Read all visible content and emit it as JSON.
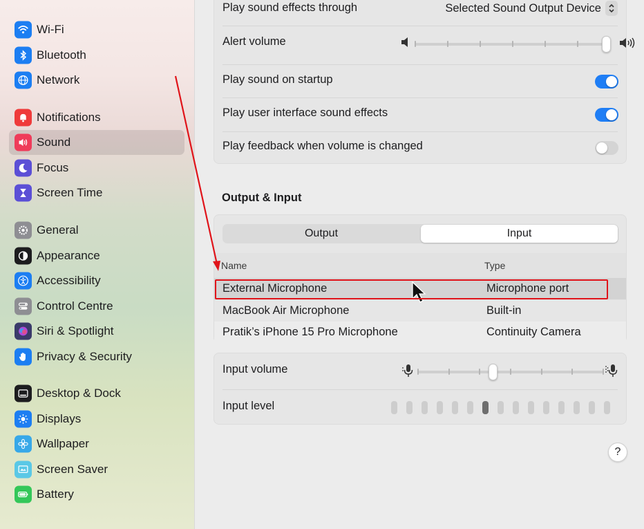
{
  "sidebar": {
    "items": [
      {
        "label": "Wi-Fi",
        "icon": "wifi-icon",
        "color": "#1c7ef2"
      },
      {
        "label": "Bluetooth",
        "icon": "bluetooth-icon",
        "color": "#1c7ef2"
      },
      {
        "label": "Network",
        "icon": "globe-icon",
        "color": "#1c7ef2"
      },
      {
        "label": "Notifications",
        "icon": "bell-icon",
        "color": "#ef3b3b"
      },
      {
        "label": "Sound",
        "icon": "speaker-icon",
        "color": "#ef3b5a"
      },
      {
        "label": "Focus",
        "icon": "moon-icon",
        "color": "#5b4fd6"
      },
      {
        "label": "Screen Time",
        "icon": "hourglass-icon",
        "color": "#5b4fd6"
      },
      {
        "label": "General",
        "icon": "gear-icon",
        "color": "#8e8e93"
      },
      {
        "label": "Appearance",
        "icon": "appearance-icon",
        "color": "#1d1d1f"
      },
      {
        "label": "Accessibility",
        "icon": "accessibility-icon",
        "color": "#1c7ef2"
      },
      {
        "label": "Control Centre",
        "icon": "control-centre-icon",
        "color": "#8e8e93"
      },
      {
        "label": "Siri & Spotlight",
        "icon": "siri-icon",
        "color": "#3a3a6a"
      },
      {
        "label": "Privacy & Security",
        "icon": "hand-icon",
        "color": "#1c7ef2"
      },
      {
        "label": "Desktop & Dock",
        "icon": "dock-icon",
        "color": "#1d1d1f"
      },
      {
        "label": "Displays",
        "icon": "sun-icon",
        "color": "#1c7ef2"
      },
      {
        "label": "Wallpaper",
        "icon": "flower-icon",
        "color": "#37a8e8"
      },
      {
        "label": "Screen Saver",
        "icon": "screensaver-icon",
        "color": "#5ac8e6"
      },
      {
        "label": "Battery",
        "icon": "battery-icon",
        "color": "#34c759"
      }
    ],
    "active": "Sound"
  },
  "sound_effects": {
    "play_through_label": "Play sound effects through",
    "play_through_value": "Selected Sound Output Device",
    "alert_volume_label": "Alert volume",
    "alert_volume_level": 1.0,
    "startup_label": "Play sound on startup",
    "startup_on": true,
    "ui_effects_label": "Play user interface sound effects",
    "ui_effects_on": true,
    "feedback_label": "Play feedback when volume is changed",
    "feedback_on": false
  },
  "output_input": {
    "title": "Output & Input",
    "tabs": [
      "Output",
      "Input"
    ],
    "selected_tab": "Input",
    "columns": {
      "name": "Name",
      "type": "Type"
    },
    "devices": [
      {
        "name": "External Microphone",
        "type": "Microphone port",
        "selected": true
      },
      {
        "name": "MacBook Air Microphone",
        "type": "Built-in",
        "selected": false
      },
      {
        "name": "Pratik’s iPhone 15 Pro Microphone",
        "type": "Continuity Camera",
        "selected": false
      }
    ],
    "input_volume_label": "Input volume",
    "input_volume_level": 0.4,
    "input_level_label": "Input level",
    "input_level_active_bar": 7,
    "input_level_bars": 15
  },
  "help_label": "?",
  "colors": {
    "accent": "#1f7ef5",
    "annotation": "#e0141a"
  }
}
